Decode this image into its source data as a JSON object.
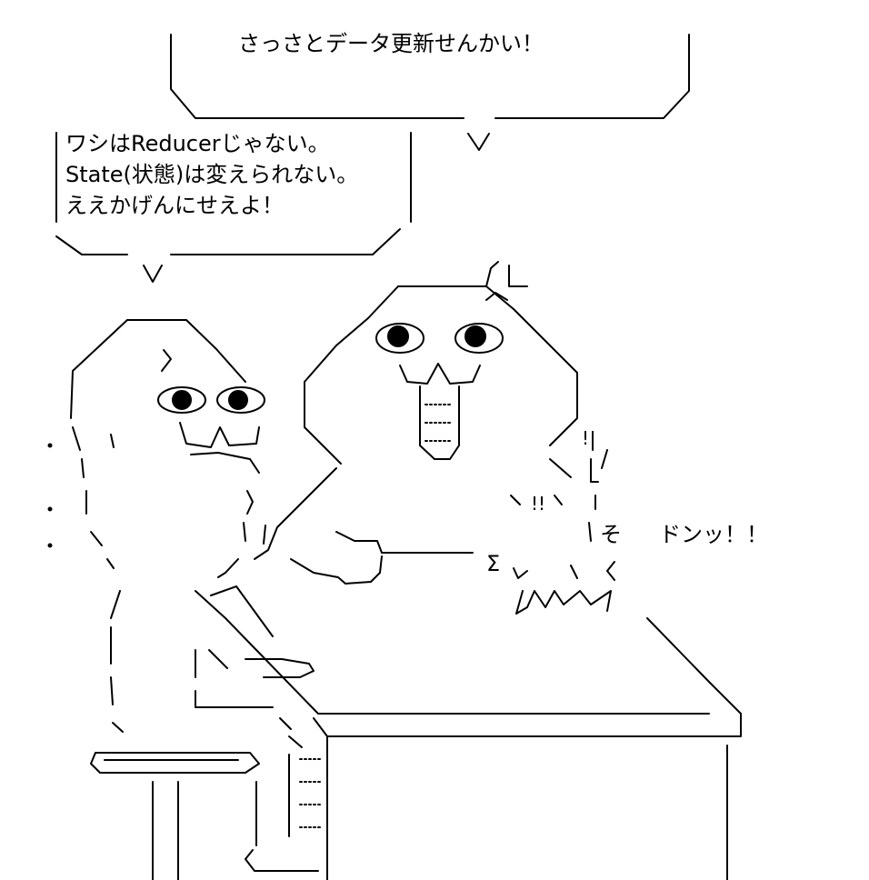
{
  "speech_top": {
    "text": "さっさとデータ更新せんかい！"
  },
  "speech_left": {
    "lines": [
      "ワシはReducerじゃない。",
      "State(状態)は変えられない。",
      "ええかげんにせえよ！"
    ]
  },
  "sfx": {
    "don": "ドンッ！！",
    "so": "そ",
    "sigma": "Σ",
    "exclaim": "!!",
    "exclaim2": "!!"
  },
  "colors": {
    "ink": "#000000",
    "paper": "#ffffff"
  }
}
